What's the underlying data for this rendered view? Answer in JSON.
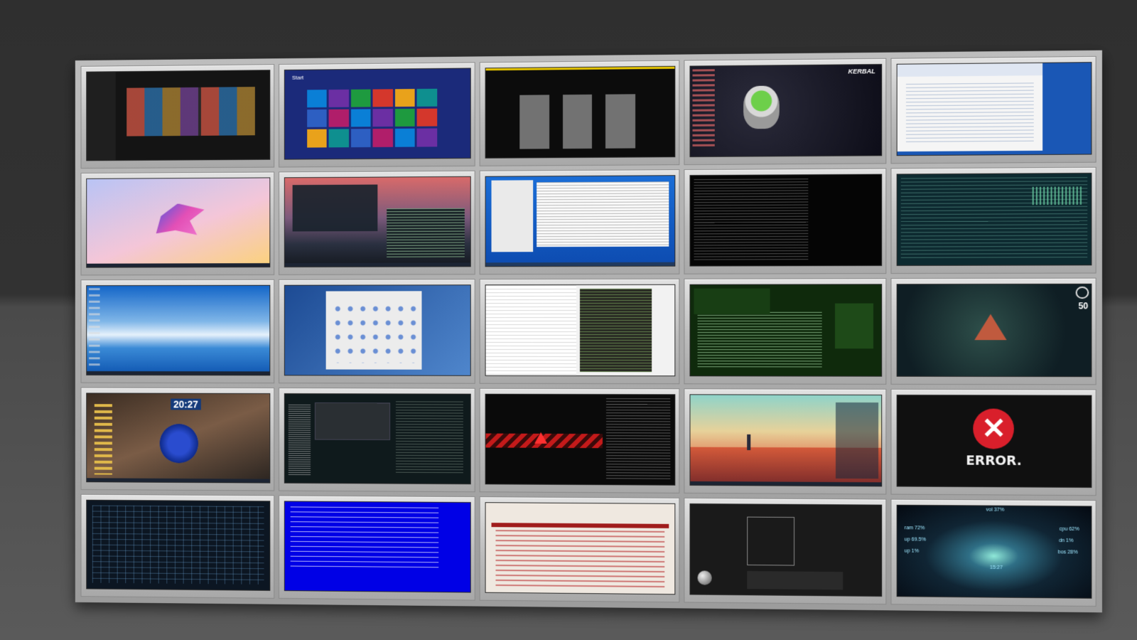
{
  "screens": [
    {
      "name": "screen-media-streaming-dark"
    },
    {
      "name": "screen-windows-8-start",
      "start_label": "Start",
      "tile_colors": [
        "#0a7fd6",
        "#6b2fa3",
        "#1e9a3f",
        "#d4372c",
        "#e9a21b",
        "#0e8f8f",
        "#2d5fc2",
        "#b01e6a"
      ]
    },
    {
      "name": "screen-3d-model-gallery"
    },
    {
      "name": "screen-kerbal-desktop",
      "logo_text": "KERBAL"
    },
    {
      "name": "screen-browser-forum-blue"
    },
    {
      "name": "screen-abstract-gradient-art"
    },
    {
      "name": "screen-linux-terminals-mountains"
    },
    {
      "name": "screen-windows-7-system-monitor"
    },
    {
      "name": "screen-black-terminal"
    },
    {
      "name": "screen-teal-terminal-dashboard"
    },
    {
      "name": "screen-lake-wallpaper-desktop"
    },
    {
      "name": "screen-macos-system-preferences"
    },
    {
      "name": "screen-file-explorer-code-editor"
    },
    {
      "name": "screen-green-hacker-terminal"
    },
    {
      "name": "screen-nebula-triangle-widgets",
      "widget_value": "50"
    },
    {
      "name": "screen-sci-fi-clock-desktop",
      "clock_text": "20:27"
    },
    {
      "name": "screen-dark-sound-visualizer"
    },
    {
      "name": "screen-red-warning-terminal"
    },
    {
      "name": "screen-no-mans-sky-desktop"
    },
    {
      "name": "screen-error",
      "error_text": "ERROR."
    },
    {
      "name": "screen-blue-hud-interface"
    },
    {
      "name": "screen-blue-screen-text"
    },
    {
      "name": "screen-red-forum-browser"
    },
    {
      "name": "screen-3d-modeling-software"
    },
    {
      "name": "screen-galaxy-stats-desktop",
      "stats": [
        "ram 72%",
        "cpu 62%",
        "up 69.5%",
        "dn 1%",
        "up 1%",
        "bos 28%",
        "vol 37%",
        "15:27"
      ]
    }
  ]
}
